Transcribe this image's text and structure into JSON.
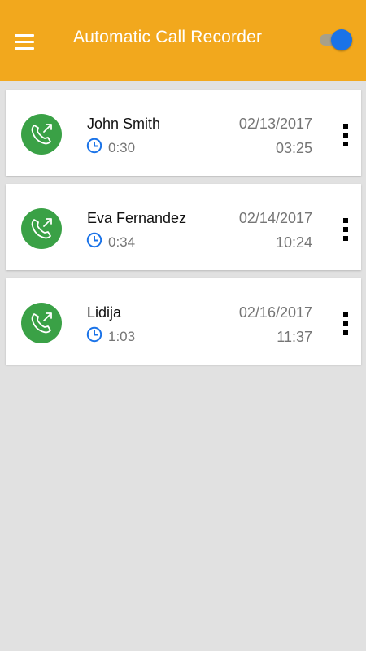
{
  "appbar": {
    "title": "Automatic Call Recorder",
    "menu_icon": "hamburger-menu-icon",
    "toggle": {
      "state": "on",
      "color": "#1a73e8"
    },
    "background": "#f2a81d"
  },
  "calls": [
    {
      "name": "John Smith",
      "duration": "0:30",
      "date": "02/13/2017",
      "time": "03:25",
      "icon": "outgoing-call-icon"
    },
    {
      "name": "Eva Fernandez",
      "duration": "0:34",
      "date": "02/14/2017",
      "time": "10:24",
      "icon": "outgoing-call-icon"
    },
    {
      "name": "Lidija",
      "duration": "1:03",
      "date": "02/16/2017",
      "time": "11:37",
      "icon": "outgoing-call-icon"
    }
  ],
  "colors": {
    "call_icon_bg": "#3aa146",
    "clock_icon": "#1a73e8",
    "screen_bg": "#e1e1e1"
  }
}
